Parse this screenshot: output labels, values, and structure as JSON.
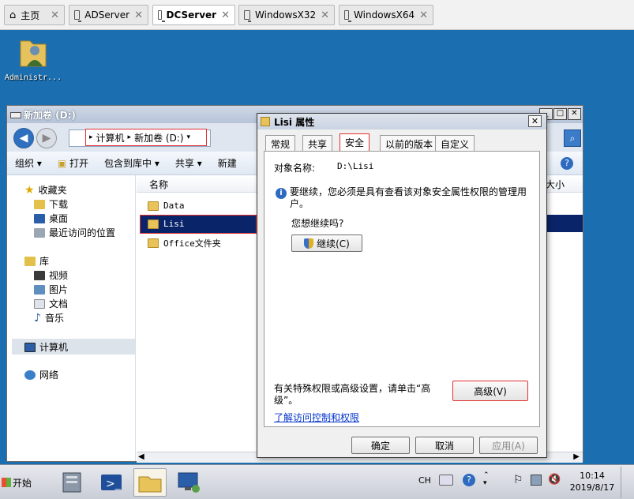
{
  "host_tabs": [
    {
      "label": "主页",
      "active": false
    },
    {
      "label": "ADServer",
      "active": false
    },
    {
      "label": "DCServer",
      "active": true
    },
    {
      "label": "WindowsX32",
      "active": false
    },
    {
      "label": "WindowsX64",
      "active": false
    }
  ],
  "desktop": {
    "icon_label": "Administr..."
  },
  "explorer": {
    "title": "新加卷 (D:)",
    "breadcrumb": [
      "计算机",
      "新加卷 (D:)"
    ],
    "toolbar": [
      "组织",
      "打开",
      "包含到库中",
      "共享",
      "新建"
    ],
    "nav": {
      "favorites": "收藏夹",
      "fav_items": [
        "下载",
        "桌面",
        "最近访问的位置"
      ],
      "libraries": "库",
      "lib_items": [
        "视频",
        "图片",
        "文档",
        "音乐"
      ],
      "computer": "计算机",
      "network": "网络"
    },
    "columns": {
      "name": "名称",
      "size": "大小"
    },
    "files": [
      "Data",
      "Lisi",
      "Office文件夹"
    ]
  },
  "dialog": {
    "title": "Lisi 属性",
    "tabs": [
      "常规",
      "共享",
      "安全",
      "以前的版本",
      "自定义"
    ],
    "selected_tab": "安全",
    "object_label": "对象名称:",
    "object_value": "D:\\Lisi",
    "info_text": "要继续，您必须是具有查看该对象安全属性权限的管理用户。",
    "question": "您想继续吗?",
    "continue_button": "继续(C)",
    "advanced_hint": "有关特殊权限或高级设置，请单击“高级”。",
    "advanced_button": "高级(V)",
    "learn_link": "了解访问控制和权限",
    "ok": "确定",
    "cancel": "取消",
    "apply": "应用(A)"
  },
  "taskbar": {
    "start": "开始",
    "lang": "CH",
    "time": "10:14",
    "date": "2019/8/17"
  },
  "colors": {
    "highlight": "#e53030",
    "selection": "#0a246a",
    "link": "#0033cc"
  }
}
